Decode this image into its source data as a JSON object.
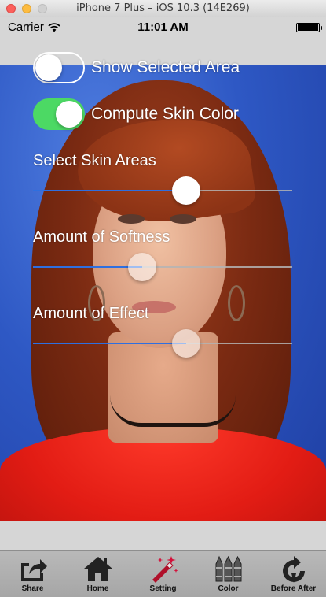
{
  "window": {
    "title": "iPhone 7 Plus – iOS 10.3 (14E269)"
  },
  "status_bar": {
    "carrier": "Carrier",
    "time": "11:01 AM",
    "battery_fraction": 1.0
  },
  "controls": {
    "show_selected_area": {
      "label": "Show Selected Area",
      "on": false
    },
    "compute_skin_color": {
      "label": "Compute Skin Color",
      "on": true
    },
    "select_skin_areas": {
      "label": "Select Skin Areas",
      "value": 0.59
    },
    "amount_of_softness": {
      "label": "Amount of Softness",
      "value": 0.42
    },
    "amount_of_effect": {
      "label": "Amount of Effect",
      "value": 0.59
    }
  },
  "colors": {
    "switch_on": "#4cd964",
    "slider_fill": "#2e6fe0",
    "photo_background": "#2e58c4",
    "shirt": "#e21c14"
  },
  "tabbar": {
    "tabs": [
      {
        "label": "Share",
        "icon": "share-icon"
      },
      {
        "label": "Home",
        "icon": "home-icon"
      },
      {
        "label": "Setting",
        "icon": "magic-wand-icon"
      },
      {
        "label": "Color",
        "icon": "crayons-icon"
      },
      {
        "label": "Before After",
        "icon": "refresh-icon"
      }
    ]
  }
}
